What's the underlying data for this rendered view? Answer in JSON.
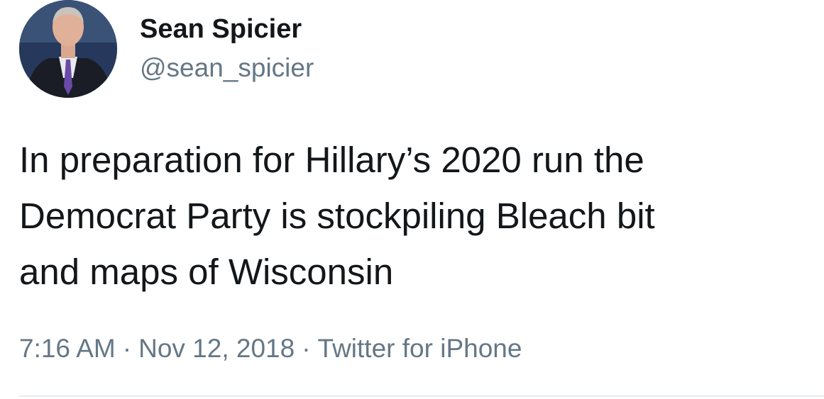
{
  "author": {
    "display_name": "Sean Spicier",
    "handle": "@sean_spicier",
    "avatar_icon": "profile-photo"
  },
  "tweet": {
    "text_lines": [
      "In preparation for Hillary’s 2020 run the",
      "Democrat Party is stockpiling Bleach bit",
      "and maps of Wisconsin"
    ]
  },
  "meta": {
    "time": "7:16 AM",
    "separator": "·",
    "date": "Nov 12, 2018",
    "source": "Twitter for iPhone"
  },
  "colors": {
    "text": "#14171a",
    "secondary": "#657786",
    "divider": "#e6ecf0"
  }
}
